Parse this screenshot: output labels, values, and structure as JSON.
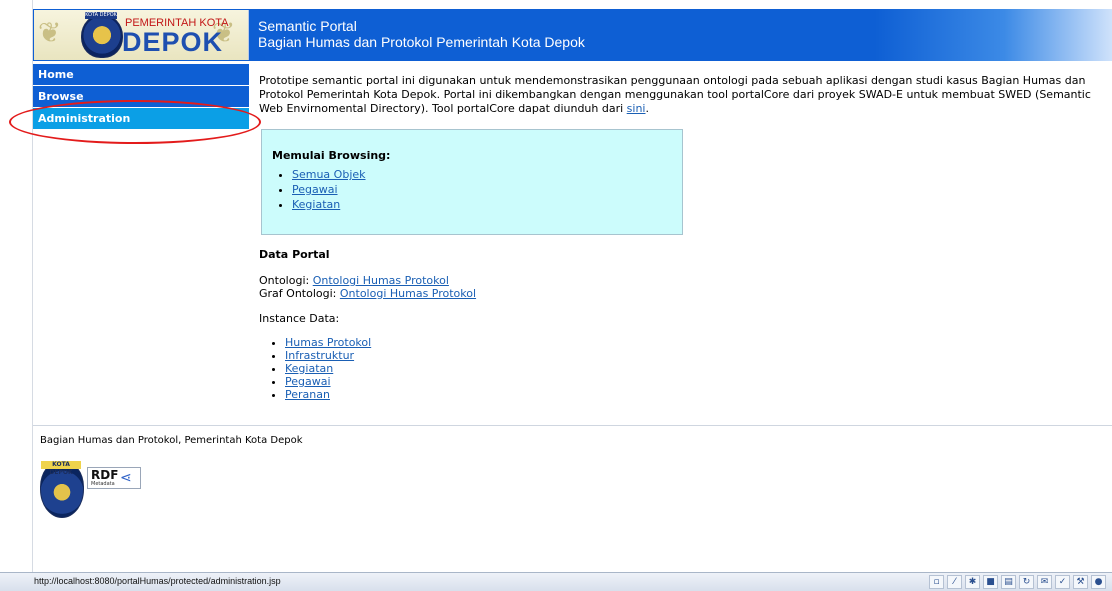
{
  "header": {
    "logo_line1": "PEMERINTAH KOTA",
    "logo_line2": "DEPOK",
    "logo_tag": "KOTA DEPOK",
    "title": "Semantic Portal",
    "subtitle": "Bagian Humas dan Protokol Pemerintah Kota Depok"
  },
  "nav": {
    "items": [
      {
        "label": "Home"
      },
      {
        "label": "Browse"
      },
      {
        "label": "Administration"
      }
    ]
  },
  "content": {
    "intro_text": "Prototipe semantic portal ini digunakan untuk mendemonstrasikan penggunaan ontologi pada sebuah aplikasi dengan studi kasus Bagian Humas dan Protokol Pemerintah Kota Depok. Portal ini dikembangkan dengan menggunakan tool portalCore dari proyek SWAD-E untuk membuat SWED (Semantic Web Envirnomental Directory). Tool portalCore dapat diunduh dari",
    "intro_link": "sini",
    "intro_end": ".",
    "browse_box": {
      "title": "Memulai Browsing:",
      "links": [
        "Semua Objek",
        "Pegawai",
        "Kegiatan"
      ]
    },
    "data_portal": {
      "title": "Data Portal",
      "ontologi_label": "Ontologi:",
      "ontologi_link": "Ontologi Humas Protokol",
      "graf_label": "Graf Ontologi:",
      "graf_link": "Ontologi Humas Protokol",
      "instance_title": "Instance Data:",
      "instances": [
        "Humas Protokol",
        "Infrastruktur",
        "Kegiatan",
        "Pegawai",
        "Peranan"
      ]
    }
  },
  "footer": {
    "text": "Bagian Humas dan Protokol, Pemerintah Kota Depok",
    "seal_tag": "KOTA DEPOK",
    "rdf_label": "RDF",
    "rdf_sub": "Metadata"
  },
  "statusbar": {
    "url": "http://localhost:8080/portalHumas/protected/administration.jsp",
    "icons": [
      "page-icon",
      "pen-icon",
      "tool-icon",
      "save-icon",
      "print-icon",
      "refresh-icon",
      "mail-icon",
      "check-icon",
      "settings-icon",
      "info-icon"
    ]
  },
  "colors": {
    "header_blue": "#0e5fd4",
    "nav_active": "#0b9fe6",
    "browse_box_bg": "#ccfcfc",
    "highlight": "#e31b1b"
  }
}
